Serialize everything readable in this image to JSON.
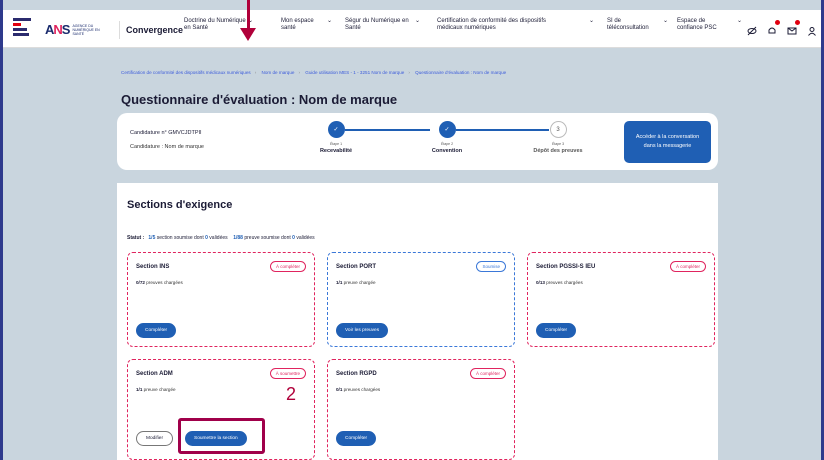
{
  "header": {
    "logo_text": "AGENCE DU NUMÉRIQUE EN SANTÉ",
    "app_name": "Convergence",
    "nav": [
      {
        "label": "Doctrine du Numérique en Santé"
      },
      {
        "label": "Mon espace santé"
      },
      {
        "label": "Ségur du Numérique en Santé"
      },
      {
        "label": "Certification de conformité des dispositifs médicaux numériques"
      },
      {
        "label": "SI de téléconsultation"
      },
      {
        "label": "Espace de confiance PSC"
      }
    ],
    "icons": [
      "eye-off-icon",
      "bell-icon",
      "mail-icon",
      "user-icon"
    ]
  },
  "breadcrumb": [
    "Certification de conformité des dispositifs médicaux numériques",
    "Nom de marque",
    "Guide utilisation MES - 1 - 3251 Nom de marque",
    "Questionnaire d'évaluation : Nom de marque"
  ],
  "page_title": "Questionnaire d'évaluation : Nom de marque",
  "stepper": {
    "candidature_id": "Candidature n° GMVCJDTPII",
    "candidature_name": "Candidature : Nom de marque",
    "steps": [
      {
        "num": "Étape 1",
        "label": "Recevabilité",
        "state": "done",
        "mark": "✓"
      },
      {
        "num": "Étape 2",
        "label": "Convention",
        "state": "done",
        "mark": "✓"
      },
      {
        "num": "Étape 3",
        "label": "Dépôt des preuves",
        "state": "todo",
        "mark": "3"
      }
    ],
    "cta": "Accéder à la conversation dans la messagerie"
  },
  "sections": {
    "title": "Sections d'exigence",
    "status_prefix": "Statut :",
    "status_sections_count": "1/5",
    "status_sections_text": "section soumise dont",
    "status_sections_valid": "0",
    "status_sections_suffix": "validées",
    "status_proofs_count": "1/88",
    "status_proofs_text": "preuve soumise dont",
    "status_proofs_valid": "0",
    "status_proofs_suffix": "validées",
    "cards": [
      {
        "name": "Section INS",
        "badge": "À compléter",
        "count": "0/72",
        "count_text": "preuves chargées",
        "button": "Compléter"
      },
      {
        "name": "Section PORT",
        "badge": "Soumise",
        "count": "1/1",
        "count_text": "preuve chargée",
        "button": "Voir les preuves"
      },
      {
        "name": "Section PGSSI-S IEU",
        "badge": "À compléter",
        "count": "0/13",
        "count_text": "preuves chargées",
        "button": "Compléter"
      },
      {
        "name": "Section ADM",
        "badge": "À soumettre",
        "count": "1/1",
        "count_text": "preuve chargée",
        "button_secondary": "Modifier",
        "button": "Soumettre la section"
      },
      {
        "name": "Section RGPD",
        "badge": "À compléter",
        "count": "0/1",
        "count_text": "preuves chargées",
        "button": "Compléter"
      }
    ]
  },
  "annotation": {
    "number": "2"
  },
  "colors": {
    "primary": "#1f5fb4",
    "alert": "#e0245e",
    "annotation": "#a0004a"
  }
}
